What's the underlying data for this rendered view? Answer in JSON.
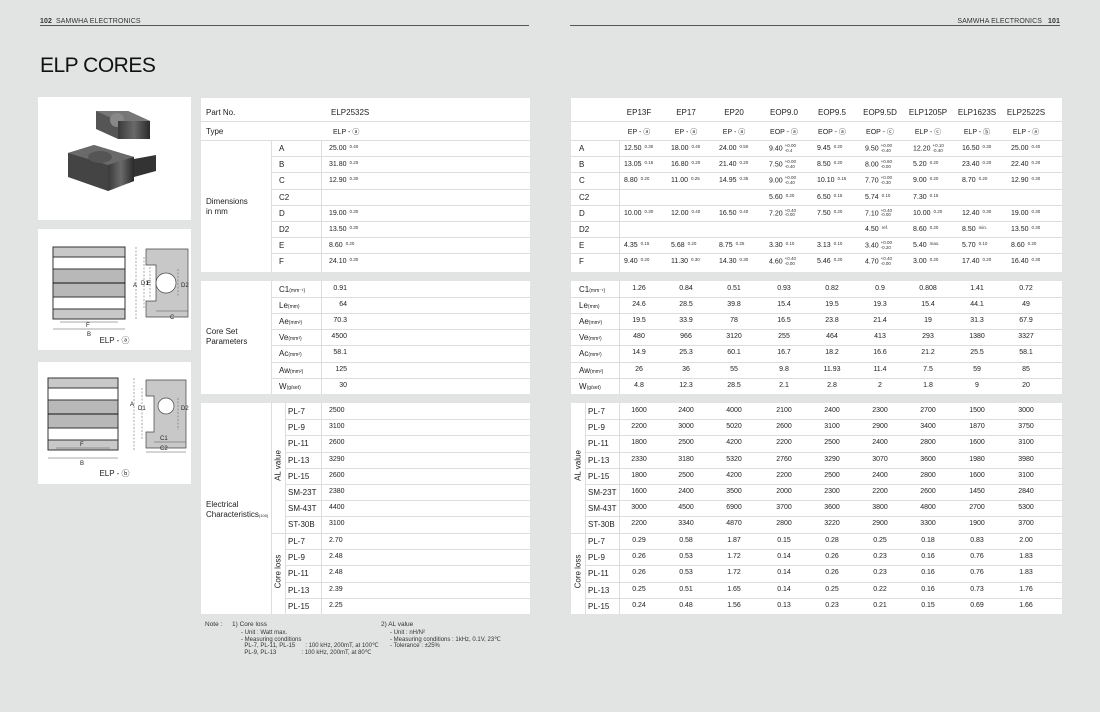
{
  "header": {
    "left_page": "102",
    "left_brand": "SAMWHA ELECTRONICS",
    "right_brand": "SAMWHA ELECTRONICS",
    "right_page": "101"
  },
  "title": "ELP CORES",
  "captions": {
    "a": "ELP - ⓐ",
    "b": "ELP - ⓑ"
  },
  "diag_labels": {
    "A": "A",
    "B": "B",
    "C": "C",
    "D": "D",
    "D1": "D1",
    "D2": "D2",
    "E": "E",
    "F": "F",
    "C1": "C1",
    "C2": "C2"
  },
  "left_table": {
    "partno_label": "Part No.",
    "partno": "ELP2532S",
    "type_label": "Type",
    "type": "ELP - ⓐ",
    "dim_label": "Dimensions\nin mm",
    "dim_keys": [
      "A",
      "B",
      "C",
      "C2",
      "D",
      "D2",
      "E",
      "F"
    ],
    "dim_vals": [
      [
        "25.00",
        "0.40"
      ],
      [
        "31.80",
        "0.20"
      ],
      [
        "12.90",
        "0.30"
      ],
      [
        "",
        ""
      ],
      [
        "19.00",
        "0.30"
      ],
      [
        "13.50",
        "0.30"
      ],
      [
        "8.60",
        "0.20"
      ],
      [
        "24.10",
        "0.30"
      ]
    ],
    "core_label": "Core Set\nParameters",
    "core_keys": [
      [
        "C1",
        "(mm⁻¹)"
      ],
      [
        "Le",
        "(mm)"
      ],
      [
        "Ae",
        "(mm²)"
      ],
      [
        "Ve",
        "(mm³)"
      ],
      [
        "Ac",
        "(mm²)"
      ],
      [
        "Aw",
        "(mm²)"
      ],
      [
        "W",
        "(g/set)"
      ]
    ],
    "core_vals": [
      "0.91",
      "64",
      "70.3",
      "4500",
      "58.1",
      "125",
      "30"
    ],
    "elec_label": "Electrical\nCharacteristics",
    "elec_sup": "(100)",
    "al_label": "AL value",
    "cl_label": "Core loss",
    "al_keys": [
      "PL-7",
      "PL-9",
      "PL-11",
      "PL-13",
      "PL-15",
      "SM-23T",
      "SM-43T",
      "ST-30B"
    ],
    "al_vals": [
      "2500",
      "3100",
      "2600",
      "3290",
      "2600",
      "2380",
      "4400",
      "3100"
    ],
    "cl_keys": [
      "PL-7",
      "PL-9",
      "PL-11",
      "PL-13",
      "PL-15"
    ],
    "cl_vals": [
      "2.70",
      "2.48",
      "2.48",
      "2.39",
      "2.25"
    ]
  },
  "notes": {
    "label": "Note :",
    "h1": "1) Core loss",
    "l1": "- Unit : Watt max.\n- Measuring conditions\n  PL-7, PL-11, PL-15      : 100 kHz, 200mT, at 100℃\n  PL-9, PL-13               : 100 kHz, 200mT, at 80℃",
    "h2": "2) AL value",
    "l2": "- Unit : nH/N²\n- Measuring conditions : 1kHz, 0.1V, 23℃\n- Tolerance : ±25%"
  },
  "right_table": {
    "parts": [
      "EP13F",
      "EP17",
      "EP20",
      "EOP9.0",
      "EOP9.5",
      "EOP9.5D",
      "ELP1205P",
      "ELP1623S",
      "ELP2522S"
    ],
    "types": [
      "EP - ⓐ",
      "EP - ⓐ",
      "EP - ⓐ",
      "EOP - ⓐ",
      "EOP - ⓐ",
      "EOP - ⓒ",
      "ELP - ⓒ",
      "ELP - ⓑ",
      "ELP - ⓐ"
    ],
    "dim_keys": [
      "A",
      "B",
      "C",
      "C2",
      "D",
      "D2",
      "E",
      "F"
    ],
    "dims": [
      [
        [
          "12.50",
          "0.30"
        ],
        [
          "18.00",
          "0.40"
        ],
        [
          "24.00",
          "0.50"
        ],
        [
          "9.40",
          "+0.00|-0.4"
        ],
        [
          "9.45",
          "0.20"
        ],
        [
          "9.50",
          "+0.00|-0.40"
        ],
        [
          "12.20",
          "+0.10|-0.40"
        ],
        [
          "16.50",
          "0.30"
        ],
        [
          "25.00",
          "0.40"
        ]
      ],
      [
        [
          "13.05",
          "0.15"
        ],
        [
          "16.80",
          "0.20"
        ],
        [
          "21.40",
          "0.20"
        ],
        [
          "7.50",
          "+0.00|-0.40"
        ],
        [
          "8.50",
          "0.20"
        ],
        [
          "8.00",
          "+0.60|-0.00"
        ],
        [
          "5.20",
          "0.20"
        ],
        [
          "23.40",
          "0.20"
        ],
        [
          "22.40",
          "0.20"
        ]
      ],
      [
        [
          "8.80",
          "0.20"
        ],
        [
          "11.00",
          "0.25"
        ],
        [
          "14.95",
          "0.35"
        ],
        [
          "9.00",
          "+0.00|-0.40"
        ],
        [
          "10.10",
          "0.15"
        ],
        [
          "7.70",
          "+0.00|-0.30"
        ],
        [
          "9.00",
          "0.20"
        ],
        [
          "8.70",
          "0.20"
        ],
        [
          "12.90",
          "0.30"
        ]
      ],
      [
        [
          "",
          ""
        ],
        [
          "",
          ""
        ],
        [
          "",
          ""
        ],
        [
          "5.60",
          "0.20"
        ],
        [
          "6.50",
          "0.15"
        ],
        [
          "5.74",
          "0.10"
        ],
        [
          "7.30",
          "0.15"
        ],
        [
          "",
          ""
        ],
        [
          "",
          ""
        ]
      ],
      [
        [
          "10.00",
          "0.30"
        ],
        [
          "12.00",
          "0.40"
        ],
        [
          "16.50",
          "0.40"
        ],
        [
          "7.20",
          "+0.40|-0.00"
        ],
        [
          "7.50",
          "0.20"
        ],
        [
          "7.10",
          "+0.40|-0.00"
        ],
        [
          "10.00",
          "0.20"
        ],
        [
          "12.40",
          "0.30"
        ],
        [
          "19.00",
          "0.30"
        ]
      ],
      [
        [
          "",
          ""
        ],
        [
          "",
          ""
        ],
        [
          "",
          ""
        ],
        [
          "",
          ""
        ],
        [
          "",
          ""
        ],
        [
          "4.50",
          "ref."
        ],
        [
          "8.60",
          "0.20"
        ],
        [
          "8.50",
          "min."
        ],
        [
          "13.50",
          "0.30"
        ]
      ],
      [
        [
          "4.35",
          "0.15"
        ],
        [
          "5.68",
          "0.20"
        ],
        [
          "8.75",
          "0.25"
        ],
        [
          "3.30",
          "0.10"
        ],
        [
          "3.13",
          "0.10"
        ],
        [
          "3.40",
          "+0.00|-0.20"
        ],
        [
          "5.40",
          "max."
        ],
        [
          "5.70",
          "0.10"
        ],
        [
          "8.60",
          "0.20"
        ]
      ],
      [
        [
          "9.40",
          "0.20"
        ],
        [
          "11.30",
          "0.30"
        ],
        [
          "14.30",
          "0.30"
        ],
        [
          "4.60",
          "+0.40|-0.00"
        ],
        [
          "5.46",
          "0.20"
        ],
        [
          "4.70",
          "+0.40|-0.00"
        ],
        [
          "3.00",
          "0.20"
        ],
        [
          "17.40",
          "0.20"
        ],
        [
          "16.40",
          "0.30"
        ]
      ]
    ],
    "core_keys": [
      [
        "C1",
        "(mm⁻¹)"
      ],
      [
        "Le",
        "(mm)"
      ],
      [
        "Ae",
        "(mm²)"
      ],
      [
        "Ve",
        "(mm³)"
      ],
      [
        "Ac",
        "(mm²)"
      ],
      [
        "Aw",
        "(mm²)"
      ],
      [
        "W",
        "(g/set)"
      ]
    ],
    "core": [
      [
        "1.26",
        "0.84",
        "0.51",
        "0.93",
        "0.82",
        "0.9",
        "0.808",
        "1.41",
        "0.72"
      ],
      [
        "24.6",
        "28.5",
        "39.8",
        "15.4",
        "19.5",
        "19.3",
        "15.4",
        "44.1",
        "49"
      ],
      [
        "19.5",
        "33.9",
        "78",
        "16.5",
        "23.8",
        "21.4",
        "19",
        "31.3",
        "67.9"
      ],
      [
        "480",
        "966",
        "3120",
        "255",
        "464",
        "413",
        "293",
        "1380",
        "3327"
      ],
      [
        "14.9",
        "25.3",
        "60.1",
        "16.7",
        "18.2",
        "16.6",
        "21.2",
        "25.5",
        "58.1"
      ],
      [
        "26",
        "36",
        "55",
        "9.8",
        "11.93",
        "11.4",
        "7.5",
        "59",
        "85"
      ],
      [
        "4.8",
        "12.3",
        "28.5",
        "2.1",
        "2.8",
        "2",
        "1.8",
        "9",
        "20"
      ]
    ],
    "al_label": "AL value",
    "cl_label": "Core loss",
    "al_keys": [
      "PL-7",
      "PL-9",
      "PL-11",
      "PL-13",
      "PL-15",
      "SM-23T",
      "SM-43T",
      "ST-30B"
    ],
    "al": [
      [
        "1600",
        "2400",
        "4000",
        "2100",
        "2400",
        "2300",
        "2700",
        "1500",
        "3000"
      ],
      [
        "2200",
        "3000",
        "5020",
        "2600",
        "3100",
        "2900",
        "3400",
        "1870",
        "3750"
      ],
      [
        "1800",
        "2500",
        "4200",
        "2200",
        "2500",
        "2400",
        "2800",
        "1600",
        "3100"
      ],
      [
        "2330",
        "3180",
        "5320",
        "2760",
        "3290",
        "3070",
        "3600",
        "1980",
        "3980"
      ],
      [
        "1800",
        "2500",
        "4200",
        "2200",
        "2500",
        "2400",
        "2800",
        "1600",
        "3100"
      ],
      [
        "1600",
        "2400",
        "3500",
        "2000",
        "2300",
        "2200",
        "2600",
        "1450",
        "2840"
      ],
      [
        "3000",
        "4500",
        "6900",
        "3700",
        "3600",
        "3800",
        "4800",
        "2700",
        "5300"
      ],
      [
        "2200",
        "3340",
        "4870",
        "2800",
        "3220",
        "2900",
        "3300",
        "1900",
        "3700"
      ]
    ],
    "cl_keys": [
      "PL-7",
      "PL-9",
      "PL-11",
      "PL-13",
      "PL-15"
    ],
    "cl": [
      [
        "0.29",
        "0.58",
        "1.87",
        "0.15",
        "0.28",
        "0.25",
        "0.18",
        "0.83",
        "2.00"
      ],
      [
        "0.26",
        "0.53",
        "1.72",
        "0.14",
        "0.26",
        "0.23",
        "0.16",
        "0.76",
        "1.83"
      ],
      [
        "0.26",
        "0.53",
        "1.72",
        "0.14",
        "0.26",
        "0.23",
        "0.16",
        "0.76",
        "1.83"
      ],
      [
        "0.25",
        "0.51",
        "1.65",
        "0.14",
        "0.25",
        "0.22",
        "0.16",
        "0.73",
        "1.76"
      ],
      [
        "0.24",
        "0.48",
        "1.56",
        "0.13",
        "0.23",
        "0.21",
        "0.15",
        "0.69",
        "1.66"
      ]
    ]
  }
}
